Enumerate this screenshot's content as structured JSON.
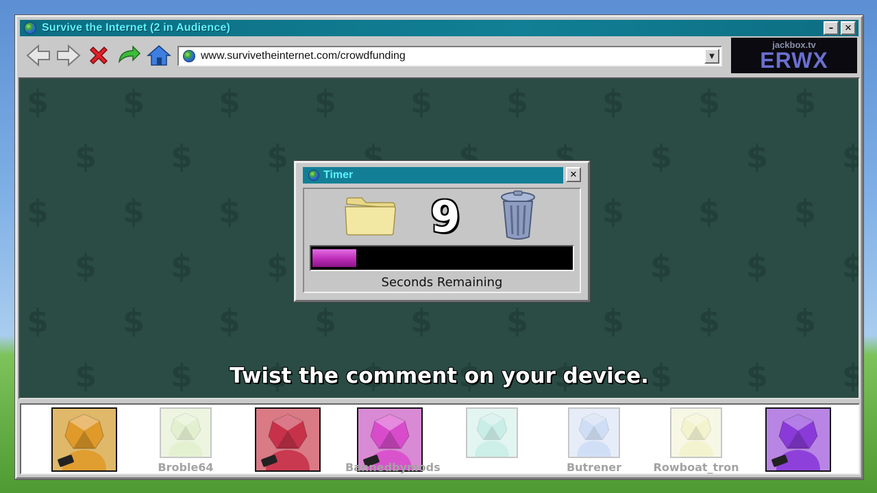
{
  "window": {
    "title": "Survive the Internet (2 in Audience)",
    "minimize": "–",
    "close": "✕"
  },
  "toolbar": {
    "icons": [
      "back-arrow-icon",
      "forward-arrow-icon",
      "stop-x-icon",
      "refresh-arrow-icon",
      "home-icon"
    ],
    "url": "www.survivetheinternet.com/crowdfunding"
  },
  "room": {
    "site": "jackbox.tv",
    "code": "ERWX"
  },
  "timer": {
    "title": "Timer",
    "close": "✕",
    "value": "9",
    "caption": "Seconds Remaining",
    "progress_fraction": 0.17,
    "bar_color": "#c030bb"
  },
  "instruction": "Twist the comment on your device.",
  "players": [
    {
      "name": "",
      "color": "#e09a2a",
      "bg": "#e0b86a",
      "active": true
    },
    {
      "name": "Broble64",
      "color": "#cde4a8",
      "bg": "#dfeec9",
      "active": false
    },
    {
      "name": "",
      "color": "#c7324a",
      "bg": "#d97a85",
      "active": true
    },
    {
      "name": "Bannedbymods",
      "color": "#d84ccc",
      "bg": "#d98ad4",
      "active": true
    },
    {
      "name": "",
      "color": "#9ee0d4",
      "bg": "#cdeee6",
      "active": false
    },
    {
      "name": "Butrener",
      "color": "#a9c2ee",
      "bg": "#d2dff4",
      "active": false
    },
    {
      "name": "Rowboat_tron",
      "color": "#eaeaa6",
      "bg": "#f2f2d2",
      "active": false
    },
    {
      "name": "",
      "color": "#8a3ad8",
      "bg": "#b985e4",
      "active": true
    }
  ]
}
